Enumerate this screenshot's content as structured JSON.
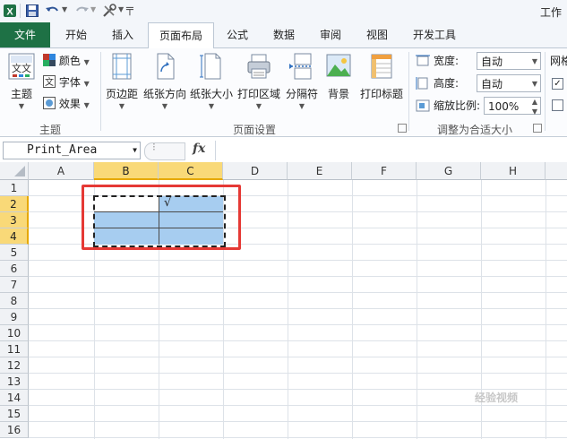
{
  "window": {
    "title": "工作"
  },
  "ribbon_tabs": [
    {
      "label": "文件"
    },
    {
      "label": "开始"
    },
    {
      "label": "插入"
    },
    {
      "label": "页面布局"
    },
    {
      "label": "公式"
    },
    {
      "label": "数据"
    },
    {
      "label": "审阅"
    },
    {
      "label": "视图"
    },
    {
      "label": "开发工具"
    }
  ],
  "themes_group": {
    "label": "主题",
    "theme_button": "主题",
    "colors": "颜色",
    "fonts": "字体",
    "effects": "效果"
  },
  "page_setup_group": {
    "label": "页面设置",
    "margins": "页边距",
    "orientation": "纸张方向",
    "size": "纸张大小",
    "print_area": "打印区域",
    "breaks": "分隔符",
    "background": "背景",
    "print_titles": "打印标题"
  },
  "scale_group": {
    "label": "调整为合适大小",
    "width_label": "宽度:",
    "width_value": "自动",
    "height_label": "高度:",
    "height_value": "自动",
    "scale_label": "缩放比例:",
    "scale_value": "100%"
  },
  "sheet_options_partial": {
    "label": "网格"
  },
  "formula_bar": {
    "name_box": "Print_Area",
    "fx": "fx"
  },
  "columns": [
    "A",
    "B",
    "C",
    "D",
    "E",
    "F",
    "G",
    "H"
  ],
  "rows": [
    "1",
    "2",
    "3",
    "4",
    "5",
    "6",
    "7",
    "8",
    "9",
    "10",
    "11",
    "12",
    "13",
    "14",
    "15",
    "16"
  ],
  "cells": {
    "C2": "√"
  },
  "watermark": "经验视频",
  "colors": {
    "file_tab": "#1e7145",
    "selection_fill": "#a7cdf0",
    "header_highlight": "#f9d978",
    "annotation_box": "#e53935"
  }
}
